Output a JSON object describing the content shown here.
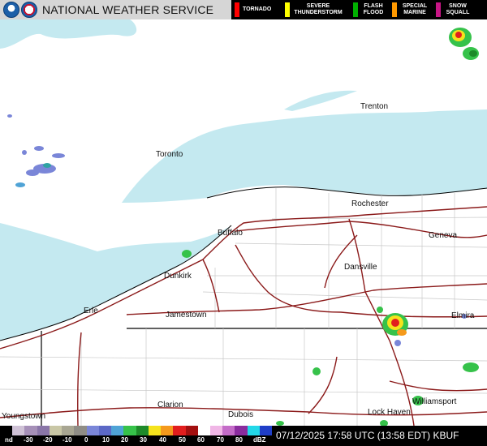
{
  "header": {
    "title": "NATIONAL WEATHER SERVICE",
    "legend": [
      {
        "name": "tornado",
        "label": "TORNADO",
        "color": "#ff0000"
      },
      {
        "name": "severe-thunderstorm",
        "label": "SEVERE THUNDERSTORM",
        "color": "#ffff00"
      },
      {
        "name": "flash-flood",
        "label": "FLASH FLOOD",
        "color": "#00b000"
      },
      {
        "name": "special-marine",
        "label": "SPECIAL MARINE",
        "color": "#ff9900"
      },
      {
        "name": "snow-squall",
        "label": "SNOW SQUALL",
        "color": "#c71585"
      }
    ]
  },
  "map": {
    "water_color": "#c4e9f0",
    "road_color": "#8b1a1a",
    "cities": [
      "Trenton",
      "Toronto",
      "Rochester",
      "Buffalo",
      "Geneva",
      "Dunkirk",
      "Dansville",
      "Erie",
      "Jamestown",
      "Elmira",
      "Clarion",
      "Dubois",
      "Youngstown",
      "Lock Haven",
      "Williamsport"
    ]
  },
  "footer": {
    "timestamp": "07/12/2025 17:58 UTC (13:58 EDT) KBUF",
    "scale_labels": [
      "nd",
      "-30",
      "-20",
      "-10",
      "0",
      "10",
      "20",
      "30",
      "40",
      "50",
      "60",
      "70",
      "80",
      "dBZ"
    ]
  }
}
